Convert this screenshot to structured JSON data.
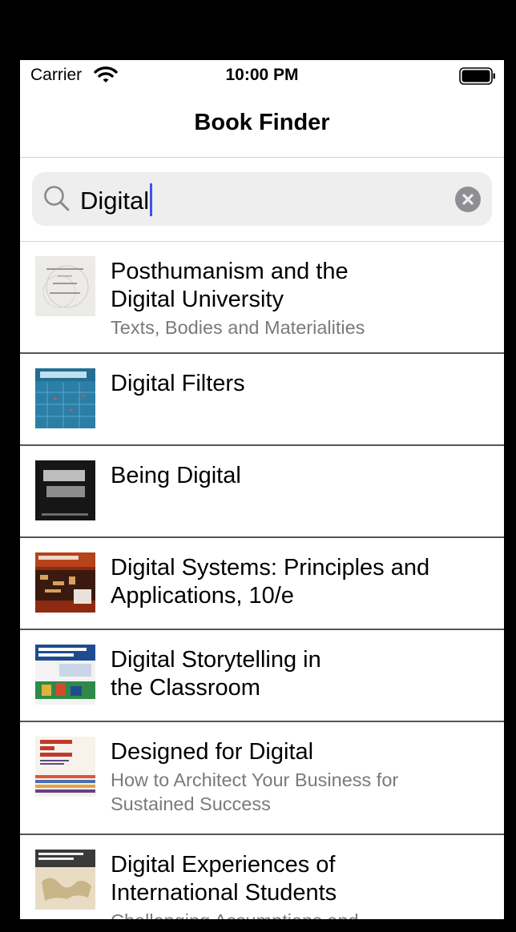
{
  "status_bar": {
    "carrier": "Carrier",
    "time": "10:00 PM"
  },
  "nav": {
    "title": "Book Finder"
  },
  "search": {
    "query": "Digital"
  },
  "results": [
    {
      "title_lines": [
        "Posthumanism and the",
        "Digital University"
      ],
      "subtitle_lines": [
        "Texts, Bodies and Materialities"
      ],
      "cover": "cover-posthumanism"
    },
    {
      "title_lines": [
        "Digital Filters"
      ],
      "subtitle_lines": [],
      "cover": "cover-digital-filters"
    },
    {
      "title_lines": [
        "Being Digital"
      ],
      "subtitle_lines": [],
      "cover": "cover-being-digital"
    },
    {
      "title_lines": [
        "Digital Systems: Principles and",
        "Applications, 10/e"
      ],
      "subtitle_lines": [],
      "cover": "cover-digital-systems"
    },
    {
      "title_lines": [
        "Digital Storytelling in",
        "the Classroom"
      ],
      "subtitle_lines": [],
      "cover": "cover-digital-storytelling"
    },
    {
      "title_lines": [
        "Designed for Digital"
      ],
      "subtitle_lines": [
        "How to Architect Your Business for",
        "Sustained Success"
      ],
      "cover": "cover-designed-for-digital"
    },
    {
      "title_lines": [
        "Digital Experiences of",
        "International Students"
      ],
      "subtitle_lines": [
        "Challenging Assumptions and"
      ],
      "cover": "cover-digital-experiences"
    }
  ],
  "colors": {
    "caret": "#3a55e8",
    "search_bg": "#eeeeef",
    "subtitle": "#7a7a7a"
  }
}
